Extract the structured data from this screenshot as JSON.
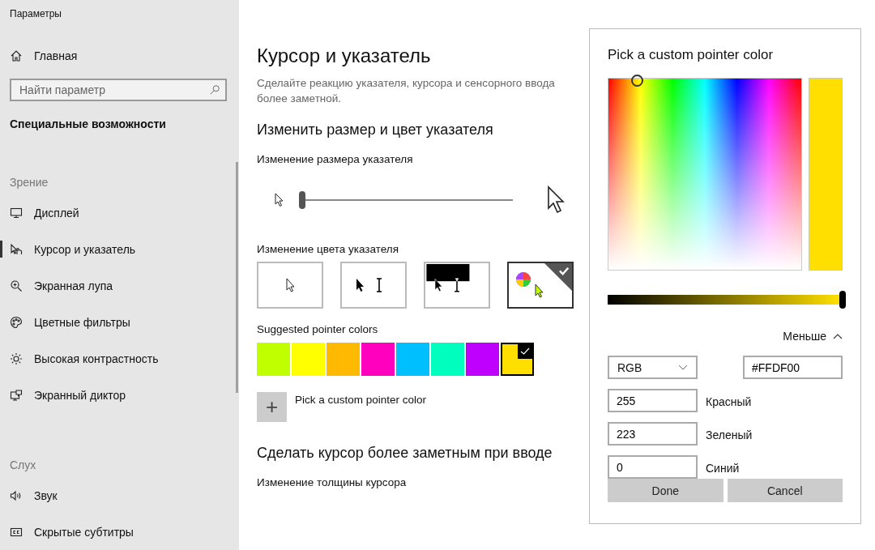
{
  "window": {
    "title": "Параметры"
  },
  "sidebar": {
    "home": "Главная",
    "search": {
      "placeholder": "Найти параметр"
    },
    "heading": "Специальные возможности",
    "groups": [
      {
        "title": "Зрение",
        "items": [
          {
            "label": "Дисплей",
            "kind": "display",
            "selected": false
          },
          {
            "label": "Курсор и указатель",
            "kind": "pointer",
            "selected": true
          },
          {
            "label": "Экранная лупа",
            "kind": "magnifier",
            "selected": false
          },
          {
            "label": "Цветные фильтры",
            "kind": "palette",
            "selected": false
          },
          {
            "label": "Высокая контрастность",
            "kind": "sun",
            "selected": false
          },
          {
            "label": "Экранный диктор",
            "kind": "narrator",
            "selected": false
          }
        ]
      },
      {
        "title": "Слух",
        "items": [
          {
            "label": "Звук",
            "kind": "speaker",
            "selected": false
          },
          {
            "label": "Скрытые субтитры",
            "kind": "cc",
            "selected": false
          }
        ]
      }
    ]
  },
  "main": {
    "title": "Курсор и указатель",
    "description": "Сделайте реакцию указателя, курсора и сенсорного ввода более заметной.",
    "section_title": "Изменить размер и цвет указателя",
    "size_label": "Изменение размера указателя",
    "size_slider": {
      "level": 0
    },
    "color_label": "Изменение цвета указателя",
    "pointer_styles": [
      {
        "kind": "white",
        "selected": false
      },
      {
        "kind": "black",
        "selected": false
      },
      {
        "kind": "inverted",
        "selected": false
      },
      {
        "kind": "custom",
        "selected": true
      }
    ],
    "suggested_label": "Suggested pointer colors",
    "suggested_colors": [
      {
        "color": "#bfff00",
        "selected": false
      },
      {
        "color": "#ffff00",
        "selected": false
      },
      {
        "color": "#ffb900",
        "selected": false
      },
      {
        "color": "#ff00bf",
        "selected": false
      },
      {
        "color": "#00bfff",
        "selected": false
      },
      {
        "color": "#00ffbf",
        "selected": false
      },
      {
        "color": "#bf00ff",
        "selected": false
      },
      {
        "color": "#ffdf00",
        "selected": true
      }
    ],
    "custom_button": {
      "icon": "+",
      "label": "Pick a custom pointer color"
    },
    "section2_title": "Сделать курсор более заметным при вводе",
    "thickness_label": "Изменение толщины курсора"
  },
  "dialog": {
    "title": "Pick a custom pointer color",
    "brightness": {
      "level": 1
    },
    "toggle": "Меньше",
    "mode": "RGB",
    "hex": "#FFDF00",
    "channels": [
      {
        "value": "255",
        "label": "Красный"
      },
      {
        "value": "223",
        "label": "Зеленый"
      },
      {
        "value": "0",
        "label": "Синий"
      }
    ],
    "buttons": [
      "Done",
      "Cancel"
    ]
  }
}
